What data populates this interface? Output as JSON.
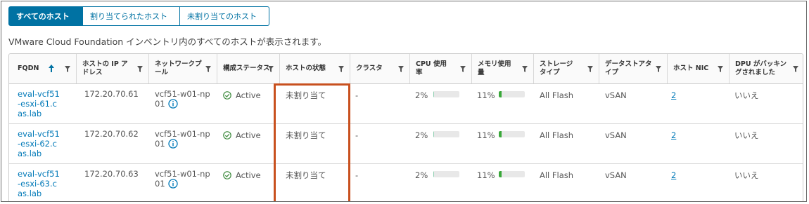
{
  "tabs": [
    {
      "label": "すべてのホスト",
      "active": true
    },
    {
      "label": "割り当てられたホスト",
      "active": false
    },
    {
      "label": "未割り当てのホスト",
      "active": false
    }
  ],
  "subtitle": "VMware Cloud Foundation インベントリ内のすべてのホストが表示されます。",
  "columns": {
    "fqdn": "FQDN",
    "ip": "ホストの IP アドレス",
    "pool": "ネットワークプール",
    "config": "構成ステータス",
    "state": "ホストの状態",
    "cluster": "クラスタ",
    "cpu": "CPU 使用率",
    "mem": "メモリ使用量",
    "storage": "ストレージタイプ",
    "datastore": "データストアタイプ",
    "nic": "ホスト NIC",
    "dpu": "DPU がバッキングされました"
  },
  "rows": [
    {
      "fqdn": "eval-vcf51-esxi-61.cas.lab",
      "ip": "172.20.70.61",
      "pool": "vcf51-w01-np01",
      "config": "Active",
      "state": "未割り当て",
      "cluster": "-",
      "cpu": "2%",
      "cpu_value": 0.02,
      "mem": "11%",
      "mem_value": 0.11,
      "storage": "All Flash",
      "datastore": "vSAN",
      "nic": "2",
      "dpu": "いいえ"
    },
    {
      "fqdn": "eval-vcf51-esxi-62.cas.lab",
      "ip": "172.20.70.62",
      "pool": "vcf51-w01-np01",
      "config": "Active",
      "state": "未割り当て",
      "cluster": "-",
      "cpu": "2%",
      "cpu_value": 0.02,
      "mem": "11%",
      "mem_value": 0.11,
      "storage": "All Flash",
      "datastore": "vSAN",
      "nic": "2",
      "dpu": "いいえ"
    },
    {
      "fqdn": "eval-vcf51-esxi-63.cas.lab",
      "ip": "172.20.70.63",
      "pool": "vcf51-w01-np01",
      "config": "Active",
      "state": "未割り当て",
      "cluster": "-",
      "cpu": "2%",
      "cpu_value": 0.02,
      "mem": "11%",
      "mem_value": 0.11,
      "storage": "All Flash",
      "datastore": "vSAN",
      "nic": "2",
      "dpu": "いいえ"
    }
  ],
  "colors": {
    "accent": "#0072a3",
    "link": "#0079b8",
    "cpu_bar": "#8ccfb0",
    "mem_bar": "#3aa83a",
    "active_icon": "#3c8a3c",
    "info_icon": "#0079b8",
    "highlight": "#c8501e"
  },
  "icons": {
    "sort": "arrow-up-icon",
    "filter": "filter-icon",
    "status": "check-circle-icon",
    "info": "info-circle-icon"
  }
}
